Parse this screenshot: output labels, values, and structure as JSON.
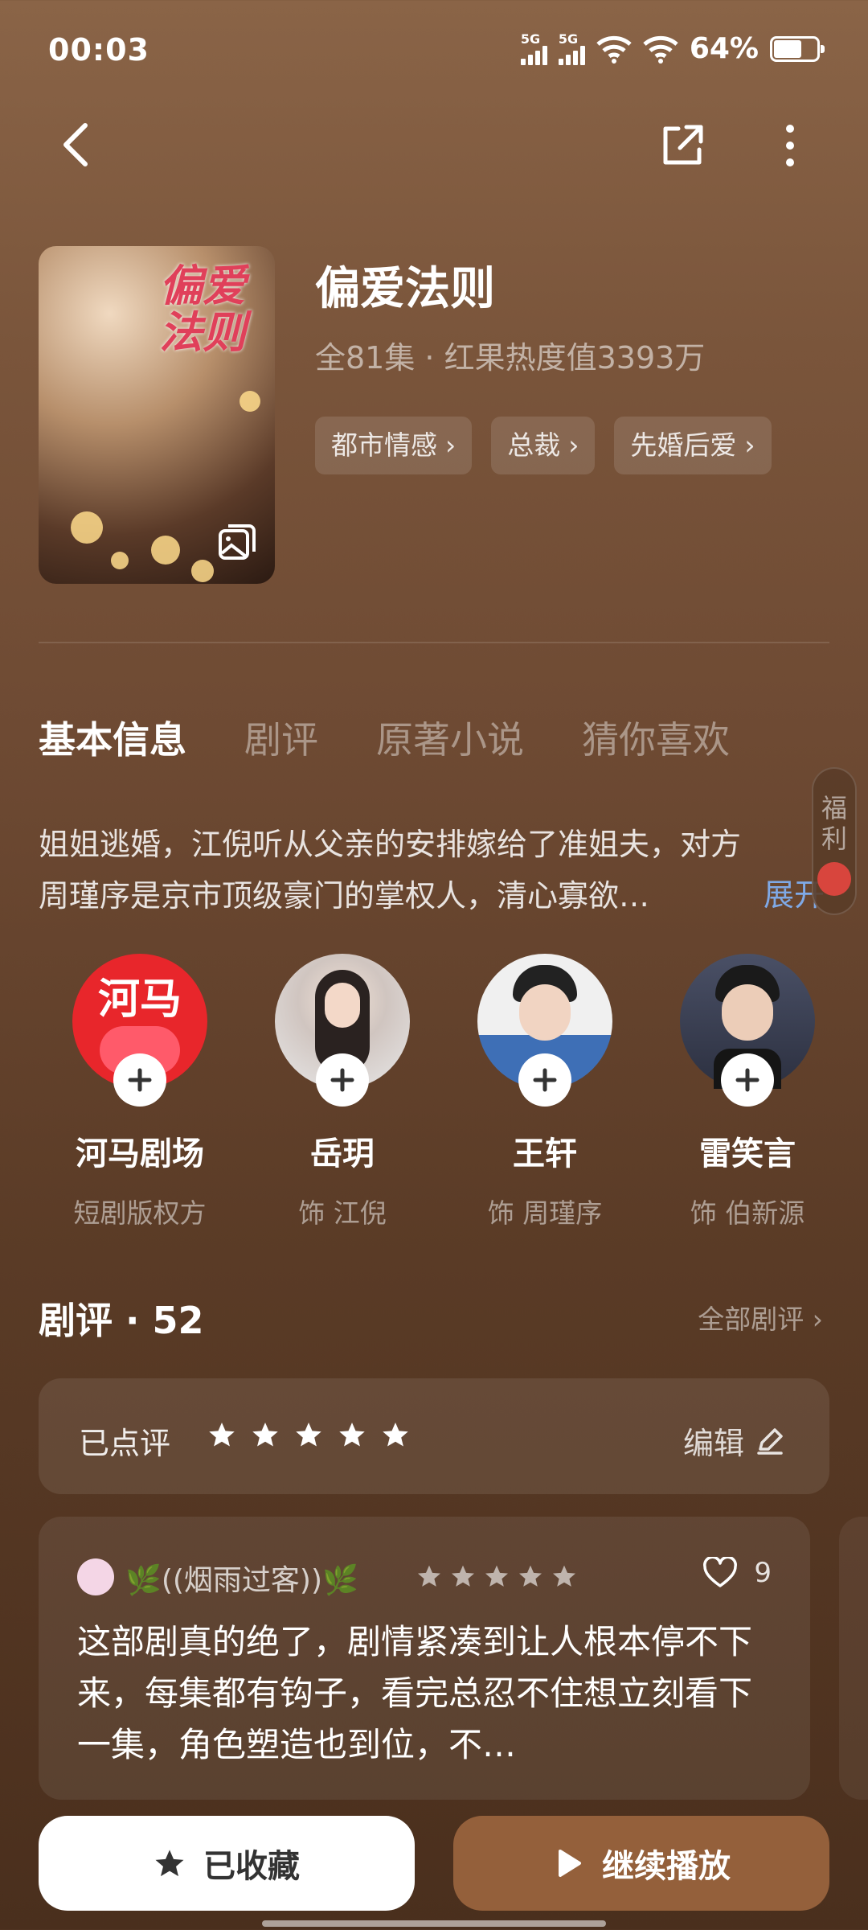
{
  "status": {
    "time": "00:03",
    "sig1": "5G",
    "sig2": "5G",
    "battery": "64%"
  },
  "drama": {
    "poster_title": "偏爱法则",
    "title": "偏爱法则",
    "meta": "全81集 · 红果热度值3393万",
    "tags": [
      "都市情感",
      "总裁",
      "先婚后爱"
    ]
  },
  "tabs": [
    "基本信息",
    "剧评",
    "原著小说",
    "猜你喜欢"
  ],
  "synopsis": {
    "line1": "姐姐逃婚，江倪听从父亲的安排嫁给了准姐夫，对方",
    "line2": "周瑾序是京市顶级豪门的掌权人，清心寡欲…",
    "expand": "展开"
  },
  "welfare": {
    "label1": "福",
    "label2": "利"
  },
  "cast": [
    {
      "name": "河马剧场",
      "role": "短剧版权方",
      "logo_text": "河马",
      "color": "#e8262b"
    },
    {
      "name": "岳玥",
      "role": "饰 江倪",
      "color": "#cfcfcf"
    },
    {
      "name": "王轩",
      "role": "饰 周瑾序",
      "color": "#3e6fb6"
    },
    {
      "name": "雷笑言",
      "role": "饰 伯新源",
      "color": "#3a3f52"
    }
  ],
  "reviews": {
    "header": "剧评 · 52",
    "all_link": "全部剧评",
    "my_label": "已点评",
    "edit_label": "编辑",
    "my_rating": 5,
    "card": {
      "user": "🌿((烟雨过客))🌿",
      "rating": 5,
      "likes": "9",
      "text": "这部剧真的绝了，剧情紧凑到让人根本停不下来，每集都有钩子，看完总忍不住想立刻看下一集，角色塑造也到位，不…"
    }
  },
  "actions": {
    "favorite": "已收藏",
    "play": "继续播放"
  }
}
